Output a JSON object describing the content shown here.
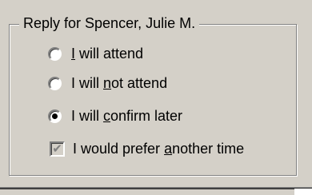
{
  "group": {
    "title": "Reply for Spencer, Julie M."
  },
  "options": [
    {
      "pre": "",
      "u": "I",
      "post": " will attend",
      "checked": false
    },
    {
      "pre": "I will ",
      "u": "n",
      "post": "ot attend",
      "checked": false
    },
    {
      "pre": "I will ",
      "u": "c",
      "post": "onfirm later",
      "checked": true
    }
  ],
  "prefer_another": {
    "pre": "I would prefer ",
    "u": "a",
    "post": "nother time",
    "checked": true,
    "disabled": true
  },
  "icons": {
    "radio_dot": "filled-circle",
    "check_mark": "check-mark"
  }
}
